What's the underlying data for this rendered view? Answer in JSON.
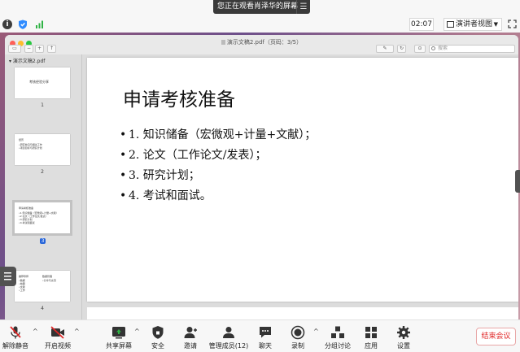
{
  "topbar": {
    "viewing_banner": "您正在观看肖泽华的屏幕",
    "timer": "02:07",
    "view_mode": "演讲者视图"
  },
  "preview_window": {
    "title": "演示文稿2.pdf（页码：3/5）",
    "search_placeholder": "搜索"
  },
  "sidebar": {
    "file_name": "演示文稿2.pdf",
    "thumbnails": [
      {
        "page": "1",
        "title": "考核经验分享",
        "lines": []
      },
      {
        "page": "2",
        "title": "经历",
        "lines": [
          "•研究前沿与相关工作",
          "•项目目标与研究计划"
        ]
      },
      {
        "page": "3",
        "title": "申请考核准备",
        "lines": [
          "•1.知识储备（宏微观+计量+文献）",
          "•2.论文（工作论文/发表）",
          "•3.研究计划",
          "•4.考试和面试"
        ]
      },
      {
        "page": "4",
        "title": "推荐导师",
        "title2": "数据管理",
        "lines": [
          "•数据",
          "•前期",
          "•文献",
          "•工作"
        ],
        "lines2": [
          "•分享与交流"
        ]
      }
    ],
    "current_page": "3"
  },
  "slide": {
    "title": "申请考核准备",
    "bullets": [
      "1. 知识储备（宏微观+计量+文献）；",
      "2. 论文（工作论文/发表）；",
      "3. 研究计划；",
      "4. 考试和面试。"
    ]
  },
  "toolbar": {
    "unmute": "解除静音",
    "start_video": "开启视频",
    "share_screen": "共享屏幕",
    "security": "安全",
    "invite": "邀请",
    "participants": "管理成员(12)",
    "chat": "聊天",
    "record": "录制",
    "breakout": "分组讨论",
    "apps": "应用",
    "settings": "设置",
    "leave": "结束会议"
  },
  "colors": {
    "accent_blue": "#2463d9",
    "leave_red": "#e02828",
    "mute_red": "#e02828",
    "share_green": "#2fb344"
  }
}
